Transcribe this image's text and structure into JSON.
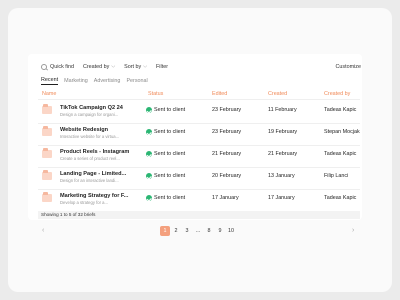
{
  "toolbar": {
    "quick_find": "Quick find",
    "created_by": "Created by",
    "sort_by": "Sort by",
    "filter": "Filter",
    "customize": "Customize"
  },
  "tabs": [
    "Recent",
    "Marketing",
    "Advertising",
    "Personal"
  ],
  "columns": {
    "name": "Name",
    "status": "Status",
    "edited": "Edited",
    "created": "Created",
    "created_by": "Created by"
  },
  "rows": [
    {
      "title": "TikTok Campaign Q2 24",
      "desc": "Design a campaign for organi...",
      "status": "Sent to client",
      "edited": "23 February",
      "created": "11 February",
      "created_by": "Tadeas Kapic"
    },
    {
      "title": "Website Redesign",
      "desc": "Interactive website for a virtua...",
      "status": "Sent to client",
      "edited": "23 February",
      "created": "19 February",
      "created_by": "Stepan Mocjak"
    },
    {
      "title": "Product Reels - Instagram",
      "desc": "Create a series of product reel...",
      "status": "Sent to client",
      "edited": "21 February",
      "created": "21 February",
      "created_by": "Tadeas Kapic"
    },
    {
      "title": "Landing Page - Limited...",
      "desc": "Design for an interactive landi...",
      "status": "Sent to client",
      "edited": "20 February",
      "created": "13 January",
      "created_by": "Filip Lanci"
    },
    {
      "title": "Marketing Strategy for F...",
      "desc": "Develop a strategy for a...",
      "status": "Sent to client",
      "edited": "17 January",
      "created": "17 January",
      "created_by": "Tadeas Kapic"
    }
  ],
  "footer": {
    "showing": "Showing 1 to 5 of 32 briefs"
  },
  "pagination": [
    "1",
    "2",
    "3",
    "...",
    "8",
    "9",
    "10"
  ],
  "colors": {
    "accent": "#f08a58",
    "status_green": "#2bb673",
    "active_page": "#f4a07e"
  }
}
